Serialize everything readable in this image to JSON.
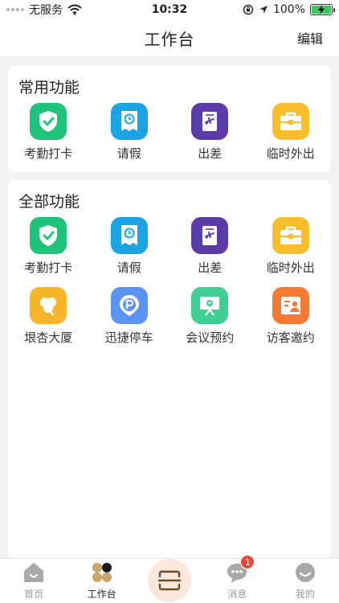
{
  "status_bar": {
    "carrier": "无服务",
    "time": "10:32",
    "battery_percent": "100%"
  },
  "nav": {
    "title": "工作台",
    "edit": "编辑"
  },
  "common": {
    "title": "常用功能",
    "items": [
      {
        "label": "考勤打卡",
        "icon": "check-shield-icon",
        "color": "#20c37a"
      },
      {
        "label": "请假",
        "icon": "clock-document-icon",
        "color": "#1aa4e4"
      },
      {
        "label": "出差",
        "icon": "airplane-ticket-icon",
        "color": "#5c3aa8"
      },
      {
        "label": "临时外出",
        "icon": "toolbox-icon",
        "color": "#f7bd2b"
      }
    ]
  },
  "all": {
    "title": "全部功能",
    "items": [
      {
        "label": "考勤打卡",
        "icon": "check-shield-icon",
        "color": "#20c37a"
      },
      {
        "label": "请假",
        "icon": "clock-document-icon",
        "color": "#1aa4e4"
      },
      {
        "label": "出差",
        "icon": "airplane-ticket-icon",
        "color": "#5c3aa8"
      },
      {
        "label": "临时外出",
        "icon": "toolbox-icon",
        "color": "#f7bd2b"
      },
      {
        "label": "垠杏大厦",
        "icon": "ginkgo-leaf-icon",
        "color": "#f7b52a"
      },
      {
        "label": "迅捷停车",
        "icon": "parking-pin-icon",
        "color": "#5a93f2"
      },
      {
        "label": "会议预约",
        "icon": "presentation-board-icon",
        "color": "#3fcf95"
      },
      {
        "label": "访客邀约",
        "icon": "visitor-card-icon",
        "color": "#f47a33"
      }
    ]
  },
  "tabbar": {
    "home": "首页",
    "workbench": "工作台",
    "messages": "消息",
    "messages_badge": "1",
    "mine": "我的",
    "accent": "#c9a46b"
  }
}
